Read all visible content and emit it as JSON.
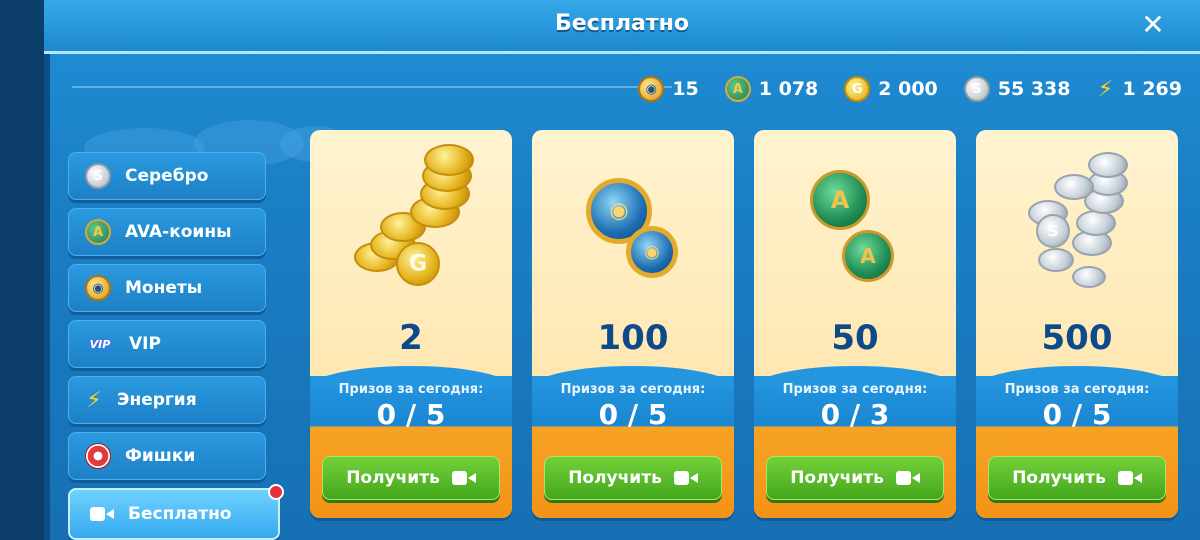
{
  "header": {
    "title": "Бесплатно",
    "close_label": "✕"
  },
  "currencies": [
    {
      "icon": "eye-coin-icon",
      "value": "15"
    },
    {
      "icon": "ava-coin-icon",
      "value": "1 078"
    },
    {
      "icon": "gold-coin-icon",
      "value": "2 000"
    },
    {
      "icon": "silver-coin-icon",
      "value": "55 338"
    },
    {
      "icon": "energy-bolt-icon",
      "value": "1 269"
    }
  ],
  "sidebar": {
    "items": [
      {
        "label": "Серебро",
        "icon": "silver-coin-icon"
      },
      {
        "label": "AVA-коины",
        "icon": "ava-coin-icon"
      },
      {
        "label": "Монеты",
        "icon": "eye-coin-icon"
      },
      {
        "label": "VIP",
        "icon": "vip-icon"
      },
      {
        "label": "Энергия",
        "icon": "energy-bolt-icon"
      },
      {
        "label": "Фишки",
        "icon": "poker-chip-icon"
      },
      {
        "label": "Бесплатно",
        "icon": "video-camera-icon",
        "active": true
      }
    ]
  },
  "cards": [
    {
      "reward": "gold-coins",
      "amount": "2",
      "prizes_label": "Призов за сегодня:",
      "prizes_count": "0 / 5",
      "button_label": "Получить"
    },
    {
      "reward": "eye-coins",
      "amount": "100",
      "prizes_label": "Призов за сегодня:",
      "prizes_count": "0 / 5",
      "button_label": "Получить"
    },
    {
      "reward": "ava-coins",
      "amount": "50",
      "prizes_label": "Призов за сегодня:",
      "prizes_count": "0 / 3",
      "button_label": "Получить"
    },
    {
      "reward": "silver-coins",
      "amount": "500",
      "prizes_label": "Призов за сегодня:",
      "prizes_count": "0 / 5",
      "button_label": "Получить"
    }
  ],
  "colors": {
    "accent": "#1f8fd6",
    "button": "#44a81c",
    "panel": "#f39318",
    "notification": "#e5303a"
  }
}
